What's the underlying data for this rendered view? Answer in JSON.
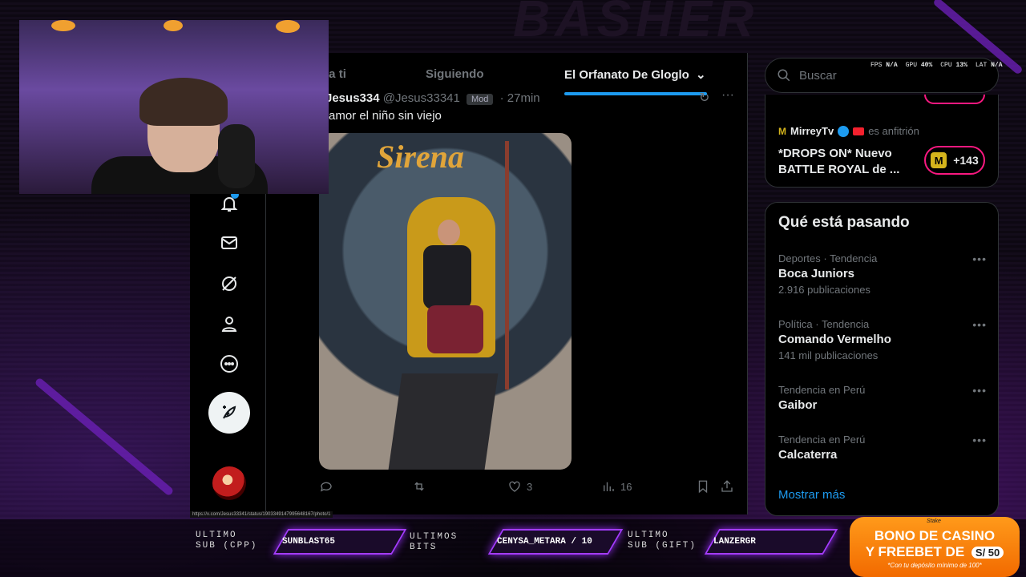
{
  "background": {
    "title": "BASHER"
  },
  "feed": {
    "tabs": [
      {
        "label": "Para ti"
      },
      {
        "label": "Siguiendo"
      },
      {
        "label": "El Orfanato De Gloglo"
      }
    ],
    "tweet": {
      "display_name": "Jesus334",
      "handle": "@Jesus33341",
      "badge": "Mod",
      "time": "27min",
      "text": "amor el niño sin viejo",
      "photo_sign": "Sirena",
      "likes": "3",
      "views": "16"
    },
    "status_url": "https://x.com/Jesus33341/status/1903349147995648167/photo/1"
  },
  "right": {
    "search_placeholder": "Buscar",
    "perf": {
      "fps_label": "FPS",
      "fps": "N/A",
      "gpu_label": "GPU",
      "gpu": "40%",
      "cpu_label": "CPU",
      "cpu": "13%",
      "lat_label": "LAT",
      "lat": "N/A"
    },
    "space": {
      "host": "MirreyTv",
      "host_suffix": "es anfitrión",
      "title": "*DROPS ON* Nuevo BATTLE ROYAL de ...",
      "listeners": "+143"
    },
    "trends_title": "Qué está pasando",
    "trends": [
      {
        "meta": "Deportes · Tendencia",
        "name": "Boca Juniors",
        "count": "2.916 publicaciones"
      },
      {
        "meta": "Política · Tendencia",
        "name": "Comando Vermelho",
        "count": "141 mil publicaciones"
      },
      {
        "meta": "Tendencia en Perú",
        "name": "Gaibor",
        "count": ""
      },
      {
        "meta": "Tendencia en Perú",
        "name": "Calcaterra",
        "count": ""
      }
    ],
    "show_more": "Mostrar más"
  },
  "overlay": {
    "last_sub_label_1": "ULTIMO",
    "last_sub_label_2": "SUB (CPP)",
    "last_sub": "SUNBLAST65",
    "last_bits_label_1": "ULTIMOS",
    "last_bits_label_2": "BITS",
    "last_bits": "CENYSA_METARA / 10",
    "last_gift_label_1": "ULTIMO",
    "last_gift_label_2": "SUB (GIFT)",
    "last_gift": "LANZERGR",
    "casino": {
      "brand": "Stake",
      "line1": "BONO DE CASINO",
      "line2": "Y FREEBET DE",
      "amount": "S/ 50",
      "line3": "*Con tu depósito mínimo de 100*"
    }
  },
  "colors": {
    "accent": "#1d9bf0",
    "overlay_purple": "#a43cff",
    "casino_orange": "#f26a00",
    "space_pink": "#f91880"
  }
}
